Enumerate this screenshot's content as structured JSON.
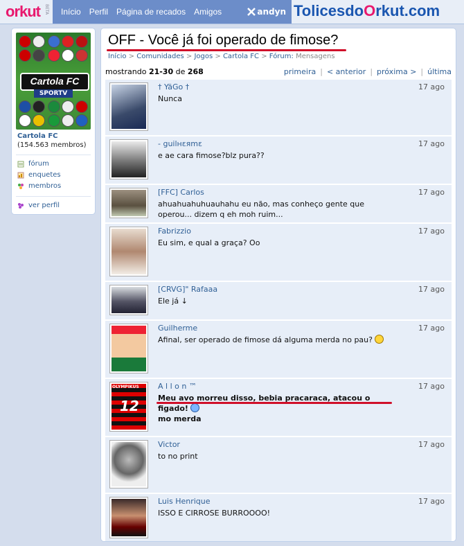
{
  "header": {
    "logo": "orkut",
    "beta": "BETA",
    "nav": [
      "Início",
      "Perfil",
      "Página de recados",
      "Amigos"
    ],
    "user": "andyn",
    "brand_a": "Tolices",
    "brand_b": "do",
    "brand_c": "O",
    "brand_d": "rkut.com"
  },
  "sidebar": {
    "community_logo_text": "Cartola FC",
    "community_logo_sub": "SPORTV",
    "community_name": "Cartola FC",
    "members": "(154.563 membros)",
    "links": [
      "fórum",
      "enquetes",
      "membros"
    ],
    "profile_link": "ver perfil"
  },
  "topic": {
    "title": "OFF - Você já foi operado de fimose?",
    "breadcrumb": [
      "Início",
      "Comunidades",
      "Jogos",
      "Cartola FC",
      "Fórum:",
      "Mensagens"
    ],
    "showing_prefix": "mostrando",
    "showing_range": "21-30",
    "showing_of": "de",
    "showing_total": "268",
    "pager": [
      "primeira",
      "< anterior",
      "próxima >",
      "última"
    ]
  },
  "posts": [
    {
      "author": "† YäGo †",
      "date": "17 ago",
      "text": "Nunca"
    },
    {
      "author": "- guilнεяmε",
      "date": "17 ago",
      "text": "e ae cara fimose?blz pura??"
    },
    {
      "author": "[FFC] Carlos",
      "date": "17 ago",
      "text": "ahuahuahuhuauhahu eu não, mas conheço gente que operou... dizem q eh moh ruim..."
    },
    {
      "author": "Fabrizzio",
      "date": "17 ago",
      "text": "Eu sim, e qual a graça? Oo"
    },
    {
      "author": "[CRVG]\" Rafaaa",
      "date": "17 ago",
      "text": "Ele já ↓"
    },
    {
      "author": "Guilherme",
      "date": "17 ago",
      "text": "Afinal, ser operado de fimose dá alguma merda no pau?"
    },
    {
      "author": "A l l o n ™",
      "date": "17 ago",
      "text": "Meu avo morreu disso, bebia pracaraca, atacou o figado!",
      "text2": "mo merda",
      "jersey_name": "OLYMPIKUS",
      "jersey_number": "12"
    },
    {
      "author": "Victor",
      "date": "17 ago",
      "text": "to no print"
    },
    {
      "author": "Luis Henrique",
      "date": "17 ago",
      "text": "ISSO E CIRROSE BURROOOO!"
    }
  ]
}
